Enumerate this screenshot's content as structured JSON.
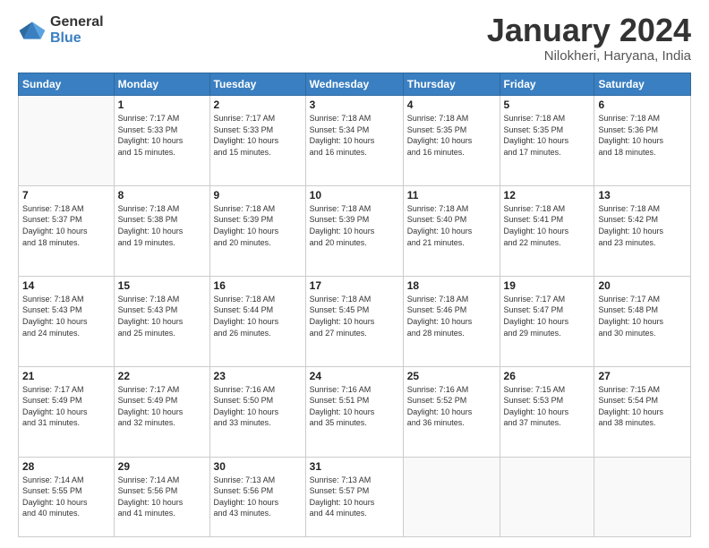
{
  "header": {
    "logo_general": "General",
    "logo_blue": "Blue",
    "title": "January 2024",
    "location": "Nilokheri, Haryana, India"
  },
  "days": [
    "Sunday",
    "Monday",
    "Tuesday",
    "Wednesday",
    "Thursday",
    "Friday",
    "Saturday"
  ],
  "weeks": [
    [
      {
        "num": "",
        "info": ""
      },
      {
        "num": "1",
        "info": "Sunrise: 7:17 AM\nSunset: 5:33 PM\nDaylight: 10 hours\nand 15 minutes."
      },
      {
        "num": "2",
        "info": "Sunrise: 7:17 AM\nSunset: 5:33 PM\nDaylight: 10 hours\nand 15 minutes."
      },
      {
        "num": "3",
        "info": "Sunrise: 7:18 AM\nSunset: 5:34 PM\nDaylight: 10 hours\nand 16 minutes."
      },
      {
        "num": "4",
        "info": "Sunrise: 7:18 AM\nSunset: 5:35 PM\nDaylight: 10 hours\nand 16 minutes."
      },
      {
        "num": "5",
        "info": "Sunrise: 7:18 AM\nSunset: 5:35 PM\nDaylight: 10 hours\nand 17 minutes."
      },
      {
        "num": "6",
        "info": "Sunrise: 7:18 AM\nSunset: 5:36 PM\nDaylight: 10 hours\nand 18 minutes."
      }
    ],
    [
      {
        "num": "7",
        "info": "Sunrise: 7:18 AM\nSunset: 5:37 PM\nDaylight: 10 hours\nand 18 minutes."
      },
      {
        "num": "8",
        "info": "Sunrise: 7:18 AM\nSunset: 5:38 PM\nDaylight: 10 hours\nand 19 minutes."
      },
      {
        "num": "9",
        "info": "Sunrise: 7:18 AM\nSunset: 5:39 PM\nDaylight: 10 hours\nand 20 minutes."
      },
      {
        "num": "10",
        "info": "Sunrise: 7:18 AM\nSunset: 5:39 PM\nDaylight: 10 hours\nand 20 minutes."
      },
      {
        "num": "11",
        "info": "Sunrise: 7:18 AM\nSunset: 5:40 PM\nDaylight: 10 hours\nand 21 minutes."
      },
      {
        "num": "12",
        "info": "Sunrise: 7:18 AM\nSunset: 5:41 PM\nDaylight: 10 hours\nand 22 minutes."
      },
      {
        "num": "13",
        "info": "Sunrise: 7:18 AM\nSunset: 5:42 PM\nDaylight: 10 hours\nand 23 minutes."
      }
    ],
    [
      {
        "num": "14",
        "info": "Sunrise: 7:18 AM\nSunset: 5:43 PM\nDaylight: 10 hours\nand 24 minutes."
      },
      {
        "num": "15",
        "info": "Sunrise: 7:18 AM\nSunset: 5:43 PM\nDaylight: 10 hours\nand 25 minutes."
      },
      {
        "num": "16",
        "info": "Sunrise: 7:18 AM\nSunset: 5:44 PM\nDaylight: 10 hours\nand 26 minutes."
      },
      {
        "num": "17",
        "info": "Sunrise: 7:18 AM\nSunset: 5:45 PM\nDaylight: 10 hours\nand 27 minutes."
      },
      {
        "num": "18",
        "info": "Sunrise: 7:18 AM\nSunset: 5:46 PM\nDaylight: 10 hours\nand 28 minutes."
      },
      {
        "num": "19",
        "info": "Sunrise: 7:17 AM\nSunset: 5:47 PM\nDaylight: 10 hours\nand 29 minutes."
      },
      {
        "num": "20",
        "info": "Sunrise: 7:17 AM\nSunset: 5:48 PM\nDaylight: 10 hours\nand 30 minutes."
      }
    ],
    [
      {
        "num": "21",
        "info": "Sunrise: 7:17 AM\nSunset: 5:49 PM\nDaylight: 10 hours\nand 31 minutes."
      },
      {
        "num": "22",
        "info": "Sunrise: 7:17 AM\nSunset: 5:49 PM\nDaylight: 10 hours\nand 32 minutes."
      },
      {
        "num": "23",
        "info": "Sunrise: 7:16 AM\nSunset: 5:50 PM\nDaylight: 10 hours\nand 33 minutes."
      },
      {
        "num": "24",
        "info": "Sunrise: 7:16 AM\nSunset: 5:51 PM\nDaylight: 10 hours\nand 35 minutes."
      },
      {
        "num": "25",
        "info": "Sunrise: 7:16 AM\nSunset: 5:52 PM\nDaylight: 10 hours\nand 36 minutes."
      },
      {
        "num": "26",
        "info": "Sunrise: 7:15 AM\nSunset: 5:53 PM\nDaylight: 10 hours\nand 37 minutes."
      },
      {
        "num": "27",
        "info": "Sunrise: 7:15 AM\nSunset: 5:54 PM\nDaylight: 10 hours\nand 38 minutes."
      }
    ],
    [
      {
        "num": "28",
        "info": "Sunrise: 7:14 AM\nSunset: 5:55 PM\nDaylight: 10 hours\nand 40 minutes."
      },
      {
        "num": "29",
        "info": "Sunrise: 7:14 AM\nSunset: 5:56 PM\nDaylight: 10 hours\nand 41 minutes."
      },
      {
        "num": "30",
        "info": "Sunrise: 7:13 AM\nSunset: 5:56 PM\nDaylight: 10 hours\nand 43 minutes."
      },
      {
        "num": "31",
        "info": "Sunrise: 7:13 AM\nSunset: 5:57 PM\nDaylight: 10 hours\nand 44 minutes."
      },
      {
        "num": "",
        "info": ""
      },
      {
        "num": "",
        "info": ""
      },
      {
        "num": "",
        "info": ""
      }
    ]
  ]
}
